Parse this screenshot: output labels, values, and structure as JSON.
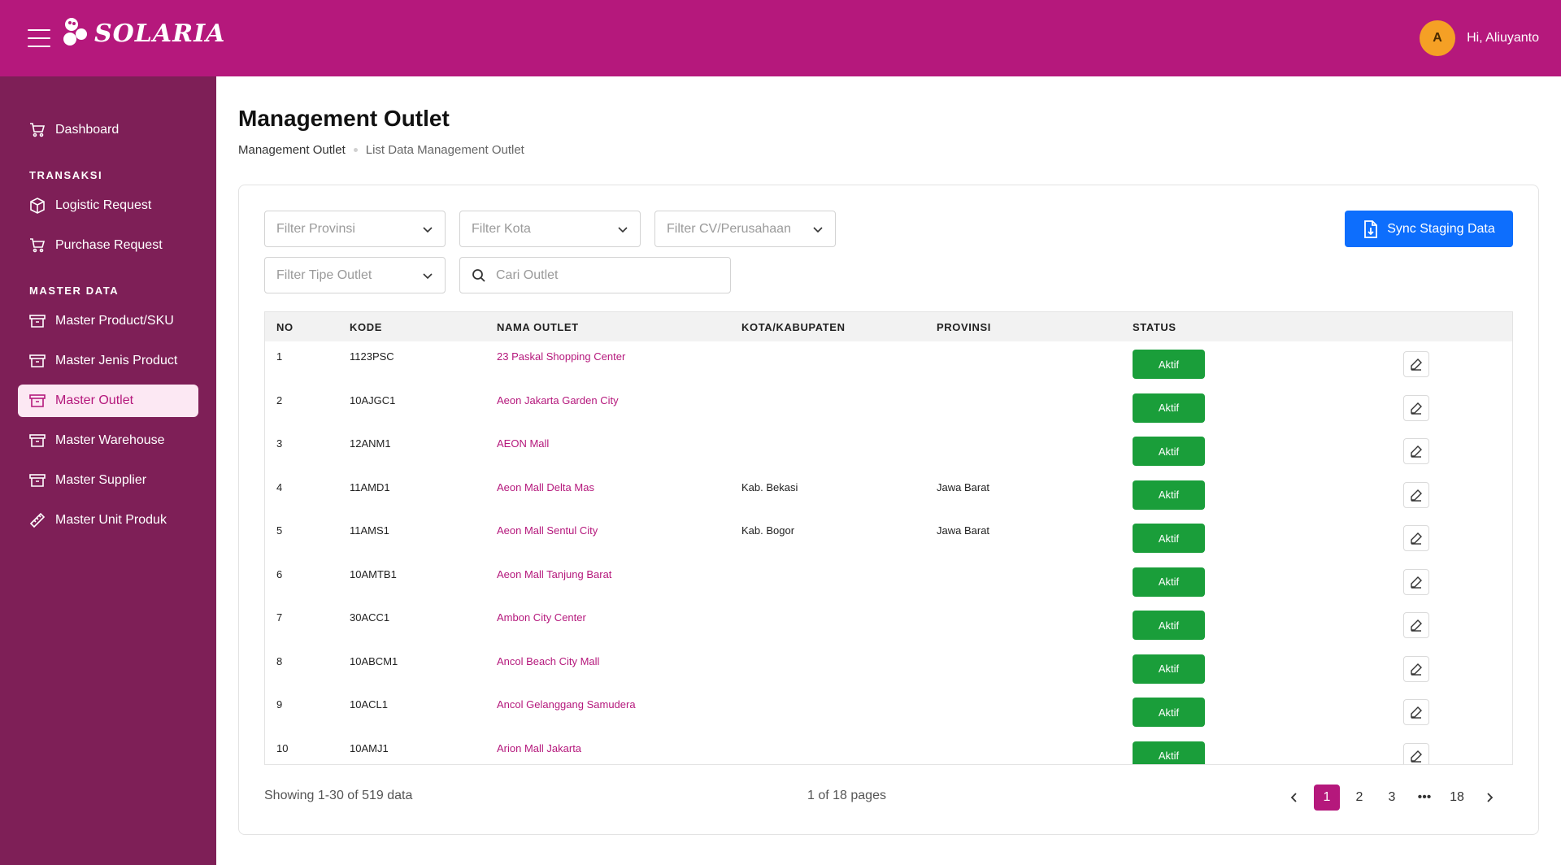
{
  "header": {
    "brand": "SOLARIA",
    "avatar_initial": "A",
    "greeting": "Hi, Aliuyanto",
    "colors": {
      "brand": "#b5187c",
      "sidebar": "#7e1f57",
      "avatar": "#f5a025"
    }
  },
  "sidebar": {
    "dashboard": "Dashboard",
    "section_transaksi": "TRANSAKSI",
    "logistic_request": "Logistic Request",
    "purchase_request": "Purchase Request",
    "section_master": "MASTER DATA",
    "master_product": "Master Product/SKU",
    "master_jenis": "Master Jenis Product",
    "master_outlet": "Master Outlet",
    "master_warehouse": "Master Warehouse",
    "master_supplier": "Master Supplier",
    "master_unit": "Master Unit Produk"
  },
  "page": {
    "title": "Management Outlet",
    "breadcrumb_root": "Management Outlet",
    "breadcrumb_current": "List Data Management Outlet"
  },
  "filters": {
    "provinsi": "Filter Provinsi",
    "kota": "Filter Kota",
    "cv": "Filter CV/Perusahaan",
    "tipe": "Filter Tipe Outlet",
    "search_placeholder": "Cari Outlet",
    "sync_button": "Sync Staging Data"
  },
  "table": {
    "headers": {
      "no": "NO",
      "kode": "KODE",
      "nama": "NAMA OUTLET",
      "kota": "KOTA/KABUPATEN",
      "provinsi": "PROVINSI",
      "status": "STATUS"
    },
    "rows": [
      {
        "no": "1",
        "kode": "1123PSC",
        "nama": "23 Paskal Shopping Center",
        "kota": "",
        "provinsi": "",
        "status": "Aktif"
      },
      {
        "no": "2",
        "kode": "10AJGC1",
        "nama": "Aeon Jakarta Garden City",
        "kota": "",
        "provinsi": "",
        "status": "Aktif"
      },
      {
        "no": "3",
        "kode": "12ANM1",
        "nama": "AEON Mall",
        "kota": "",
        "provinsi": "",
        "status": "Aktif"
      },
      {
        "no": "4",
        "kode": "11AMD1",
        "nama": "Aeon Mall Delta Mas",
        "kota": "Kab. Bekasi",
        "provinsi": "Jawa Barat",
        "status": "Aktif"
      },
      {
        "no": "5",
        "kode": "11AMS1",
        "nama": "Aeon Mall Sentul City",
        "kota": "Kab. Bogor",
        "provinsi": "Jawa Barat",
        "status": "Aktif"
      },
      {
        "no": "6",
        "kode": "10AMTB1",
        "nama": "Aeon Mall Tanjung Barat",
        "kota": "",
        "provinsi": "",
        "status": "Aktif"
      },
      {
        "no": "7",
        "kode": "30ACC1",
        "nama": "Ambon City Center",
        "kota": "",
        "provinsi": "",
        "status": "Aktif"
      },
      {
        "no": "8",
        "kode": "10ABCM1",
        "nama": "Ancol Beach City Mall",
        "kota": "",
        "provinsi": "",
        "status": "Aktif"
      },
      {
        "no": "9",
        "kode": "10ACL1",
        "nama": "Ancol Gelanggang Samudera",
        "kota": "",
        "provinsi": "",
        "status": "Aktif"
      },
      {
        "no": "10",
        "kode": "10AMJ1",
        "nama": "Arion Mall Jakarta",
        "kota": "",
        "provinsi": "",
        "status": "Aktif"
      }
    ]
  },
  "footer": {
    "showing": "Showing 1-30 of 519 data",
    "pages_info": "1 of 18 pages",
    "pages": [
      "1",
      "2",
      "3",
      "•••",
      "18"
    ]
  }
}
